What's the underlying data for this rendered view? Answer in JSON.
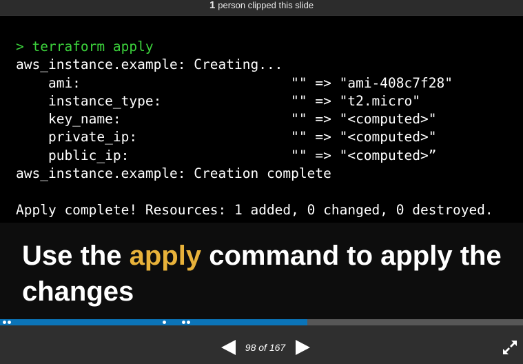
{
  "clip_bar": {
    "count": "1",
    "text": "person clipped this slide"
  },
  "terminal": {
    "command": "> terraform apply",
    "lines": [
      "aws_instance.example: Creating...",
      "    ami:                          \"\" => \"ami-408c7f28\"",
      "    instance_type:                \"\" => \"t2.micro\"",
      "    key_name:                     \"\" => \"<computed>\"",
      "    private_ip:                   \"\" => \"<computed>\"",
      "    public_ip:                    \"\" => \"<computed>”",
      "aws_instance.example: Creation complete",
      "",
      "Apply complete! Resources: 1 added, 0 changed, 0 destroyed."
    ]
  },
  "caption": {
    "before": "Use the ",
    "highlight": "apply",
    "after": " command to apply the changes",
    "highlight_color": "#e8b23a"
  },
  "progress": {
    "fraction": 0.587,
    "bar_color": "#0b74b8",
    "track_color": "#575757"
  },
  "navigation": {
    "prev_icon": "triangle-left-icon",
    "next_icon": "triangle-right-icon",
    "page_label": "98 of 167",
    "fullscreen_icon": "expand-arrows-icon"
  }
}
